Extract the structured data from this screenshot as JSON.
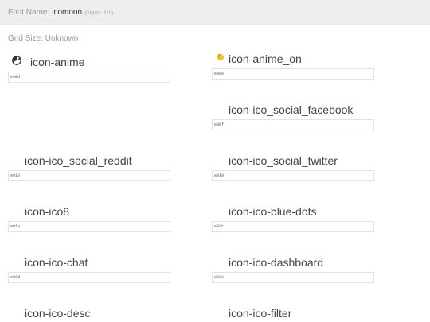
{
  "header": {
    "label": "Font Name:",
    "font_name": "icomoon",
    "glyph_count": "(Glyphs: 619)"
  },
  "grid_size": "Grid Size: Unknown",
  "glyphs": [
    {
      "name": "icon-anime",
      "code": "e90d",
      "char": "",
      "icon": "anime-icon"
    },
    {
      "name": "icon-anime_on",
      "code": "e90e",
      "char": "",
      "icon": "anime-on-icon"
    },
    {
      "name": "icon-ico_social_facebook",
      "code": "e90f",
      "char": ""
    },
    {
      "name": "icon-ico_social_reddit",
      "code": "e918",
      "char": ""
    },
    {
      "name": "icon-ico_social_twitter",
      "code": "e919",
      "char": ""
    },
    {
      "name": "icon-ico8",
      "code": "e91a",
      "char": ""
    },
    {
      "name": "icon-ico-blue-dots",
      "code": "e93c",
      "char": ""
    },
    {
      "name": "icon-ico-chat",
      "code": "e93d",
      "char": ""
    },
    {
      "name": "icon-ico-dashboard",
      "code": "e93e",
      "char": ""
    },
    {
      "name": "icon-ico-desc",
      "code": "",
      "char": ""
    },
    {
      "name": "icon-ico-filter",
      "code": "",
      "char": ""
    }
  ]
}
